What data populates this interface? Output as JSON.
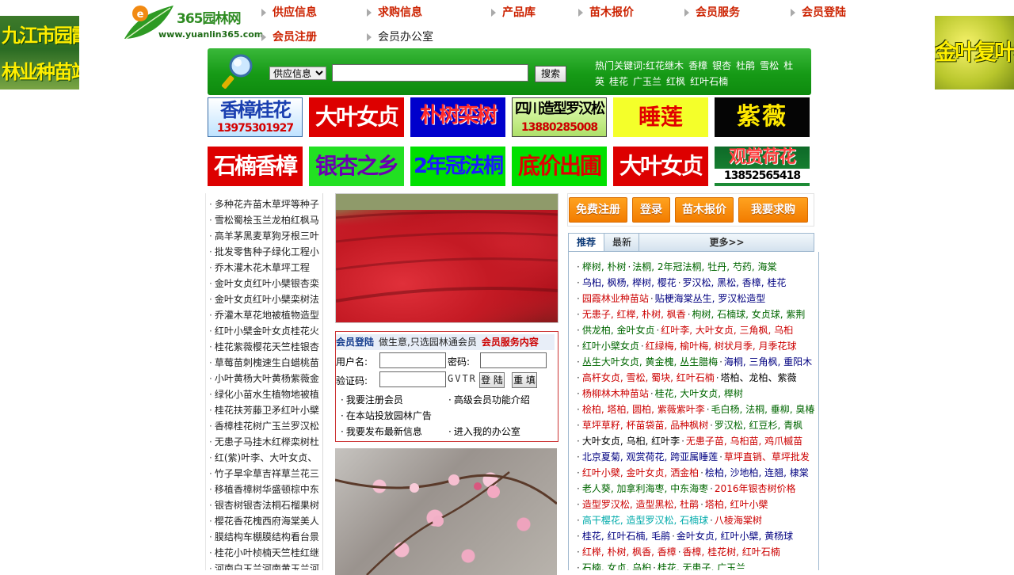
{
  "float_ads": {
    "left": {
      "line1": "九江市园霞",
      "line2": "林业种苗站"
    },
    "right": {
      "line1": "金叶复叶槭"
    }
  },
  "logo": {
    "brand": "365园林网",
    "url": "www.yuanlin365.com"
  },
  "nav": {
    "items": [
      "供应信息",
      "求购信息",
      "产品库",
      "苗木报价",
      "会员服务",
      "会员登陆",
      "会员注册",
      "会员办公室"
    ]
  },
  "search": {
    "select_value": "供应信息",
    "input_value": "",
    "button": "搜索",
    "hot_label": "热门关键词:",
    "hot_words": [
      "红花继木",
      "香樟",
      "银杏",
      "杜鹃",
      "雪松",
      "杜英",
      "桂花",
      "广玉兰",
      "红枫",
      "红叶石楠"
    ]
  },
  "banners": {
    "row1": [
      {
        "l1": "香樟桂花",
        "l2": "13975301927"
      },
      {
        "l1": "大叶女贞"
      },
      {
        "l1": "朴树栾树"
      },
      {
        "l1": "四川造型罗汉松",
        "l2": "13880285008"
      },
      {
        "l1": "睡莲"
      },
      {
        "l1": "紫薇"
      }
    ],
    "row2": [
      {
        "l1": "石楠香樟"
      },
      {
        "l1": "银杏之乡"
      },
      {
        "l1": "2年冠法桐"
      },
      {
        "l1": "底价出圃"
      },
      {
        "l1": "大叶女贞"
      },
      {
        "l1": "观赏荷花",
        "l2": "13852565418"
      }
    ]
  },
  "left_list": [
    "多种花卉苗木草坪等种子",
    "雪松蜀桧玉兰龙柏红枫马",
    "高羊茅黑麦草狗牙根三叶",
    "批发零售种子绿化工程小",
    "乔木灌木花木草坪工程",
    "金叶女贞红叶小檗银杏栾",
    "金叶女贞红叶小檗栾树法",
    "乔灌木草花地被植物造型",
    "红叶小檗金叶女贞桂花火",
    "桂花紫薇樱花天竺桂银杏",
    "草莓苗刺槐速生白蜡桃苗",
    "小叶黄杨大叶黄杨紫薇金",
    "绿化小苗水生植物地被植",
    "桂花扶芳藤卫矛红叶小檗",
    "香樟桂花树广玉兰罗汉松",
    "无患子马挂木红榉栾树杜",
    "红(紫)叶李、大叶女贞、",
    "竹子旱伞草吉祥草兰花三",
    "移植香樟树华盛顿棕中东",
    "银杏树银杏法桐石榴果树",
    "樱花香花槐西府海棠美人",
    "膜结构车棚膜结构看台景",
    "桂花小叶桢楠天竺桂红继",
    "河南白玉兰河南黄玉兰河"
  ],
  "login": {
    "title": "会员登陆",
    "slogan": "做生意,只选园林通会员",
    "member_link": "会员服务内容",
    "username_label": "用户名:",
    "password_label": "密码:",
    "captcha_label": "验证码:",
    "captcha_text": "GVTR",
    "login_btn": "登 陆",
    "reset_btn": "重 填",
    "links": [
      "我要注册会员",
      "高级会员功能介绍",
      "在本站投放园林广告",
      "我要发布最新信息",
      "进入我的办公室"
    ]
  },
  "right": {
    "buttons": [
      "免费注册",
      "登录",
      "苗木报价",
      "我要求购"
    ],
    "tabs": [
      "推荐",
      "最新",
      "更多>>"
    ],
    "rows": [
      [
        [
          "榉树, 朴树",
          "#006600"
        ],
        [
          "法桐, 2年冠法桐, 牡丹, 芍药, 海棠",
          "#006600"
        ]
      ],
      [
        [
          "乌桕, 枫杨, 榉树, 樱花",
          "#000080"
        ],
        [
          "罗汉松, 黑松, 香樟, 桂花",
          "#000080"
        ]
      ],
      [
        [
          "园霞林业种苗站",
          "#cc0000"
        ],
        [
          "贴梗海棠丛生, 罗汉松造型",
          "#000080"
        ]
      ],
      [
        [
          "无患子, 红榉, 朴树, 枫香",
          "#cc0000"
        ],
        [
          "枸树, 石楠球, 女贞球, 紫荆",
          "#006600"
        ]
      ],
      [
        [
          "供龙柏, 金叶女贞",
          "#006600"
        ],
        [
          "红叶李, 大叶女贞, 三角枫, 乌桕",
          "#cc0000"
        ]
      ],
      [
        [
          "红叶小檗女贞",
          "#006600"
        ],
        [
          "红绿梅, 榆叶梅, 树状月季, 月季花球",
          "#cc0000"
        ]
      ],
      [
        [
          "丛生大叶女贞, 黄金槐, 丛生腊梅",
          "#006600"
        ],
        [
          "海桐, 三角枫, 重阳木",
          "#000080"
        ]
      ],
      [
        [
          "高杆女贞, 雪松, 蜀块, 红叶石楠",
          "#cc0000"
        ],
        [
          "塔柏、龙柏、紫薇",
          "#000000"
        ]
      ],
      [
        [
          "杨柳林木种苗站",
          "#cc0000"
        ],
        [
          "桂花, 大叶女贞, 榉树",
          "#006600"
        ]
      ],
      [
        [
          "桧柏, 塔柏, 圆柏, 紫薇紫叶李",
          "#cc0000"
        ],
        [
          "毛白杨, 法桐, 垂柳, 臭椿",
          "#006600"
        ]
      ],
      [
        [
          "草坪草籽, 杯苗袋苗, 品种枫树",
          "#cc0000"
        ],
        [
          "罗汉松, 红豆杉, 青枫",
          "#006600"
        ]
      ],
      [
        [
          "大叶女贞, 乌桕, 红叶李",
          "#000000"
        ],
        [
          "无患子苗, 乌桕苗, 鸡爪槭苗",
          "#cc0000"
        ]
      ],
      [
        [
          "北京夏菊, 观赏荷花, 跨亚属睡莲",
          "#000080"
        ],
        [
          "草坪直销、草坪批发",
          "#cc0000"
        ]
      ],
      [
        [
          "红叶小檗, 金叶女贞, 洒金柏",
          "#cc0000"
        ],
        [
          "桧柏, 沙地柏, 连翘, 棣棠",
          "#000080"
        ]
      ],
      [
        [
          "老人葵, 加拿利海枣, 中东海枣",
          "#006600"
        ],
        [
          "2016年银杏树价格",
          "#cc0000"
        ]
      ],
      [
        [
          "造型罗汉松, 造型黑松, 杜鹃",
          "#cc0000"
        ],
        [
          "塔柏, 红叶小檗",
          "#cc0000"
        ]
      ],
      [
        [
          "高干樱花, 造型罗汉松, 石楠球",
          "#00aaaa"
        ],
        [
          "八棱海棠树",
          "#cc0000"
        ]
      ],
      [
        [
          "桂花, 红叶石楠, 毛鹃",
          "#000080"
        ],
        [
          "金叶女贞, 红叶小檗, 黄杨球",
          "#000080"
        ]
      ],
      [
        [
          "红榉, 朴树, 枫香, 香樟",
          "#cc0000"
        ],
        [
          "香樟, 桂花树, 红叶石楠",
          "#cc0000"
        ]
      ],
      [
        [
          "石楠, 女贞, 乌桕",
          "#006600"
        ],
        [
          "桂花, 无患子, 广玉兰",
          "#006600"
        ]
      ]
    ]
  }
}
